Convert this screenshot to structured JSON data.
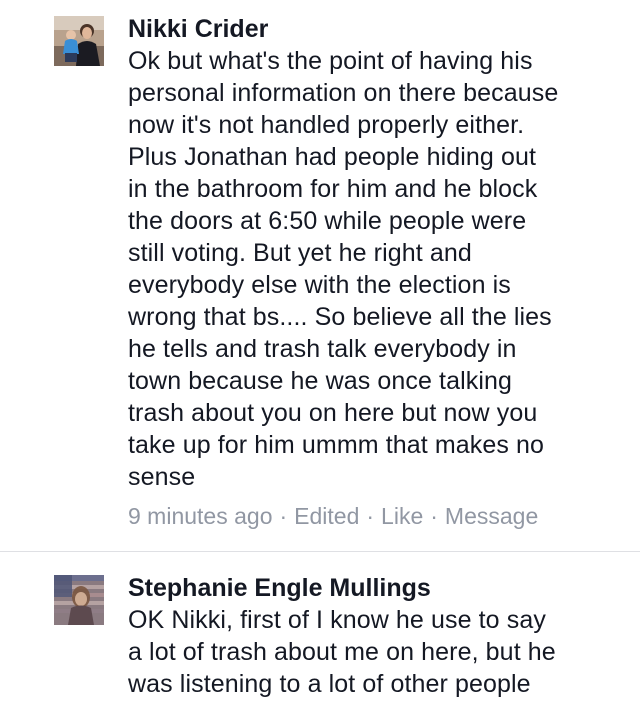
{
  "comments": [
    {
      "author": "Nikki Crider",
      "avatar_icon": "profile-photo",
      "text": "Ok but what's the point of having his\npersonal information on there because\nnow it's not handled properly either.\nPlus Jonathan had people hiding out\nin the bathroom for him and he block\nthe doors at 6:50 while people were\nstill voting. But yet he right and\neverybody else with the election is\nwrong that bs.... So believe all the lies\nhe tells and trash talk everybody in\ntown because he was once talking\ntrash about you on here but now you\ntake up for him ummm that makes no\nsense",
      "time": "9 minutes ago",
      "edited": "Edited",
      "like": "Like",
      "message": "Message",
      "separator": "·"
    },
    {
      "author": "Stephanie Engle Mullings",
      "avatar_icon": "profile-photo",
      "text": "OK Nikki, first of I know he use to say\na lot of trash about me on here, but he\nwas listening to a lot of other people"
    }
  ],
  "colors": {
    "text": "#141823",
    "meta": "#9197a3",
    "divider": "#dfe0e4"
  }
}
